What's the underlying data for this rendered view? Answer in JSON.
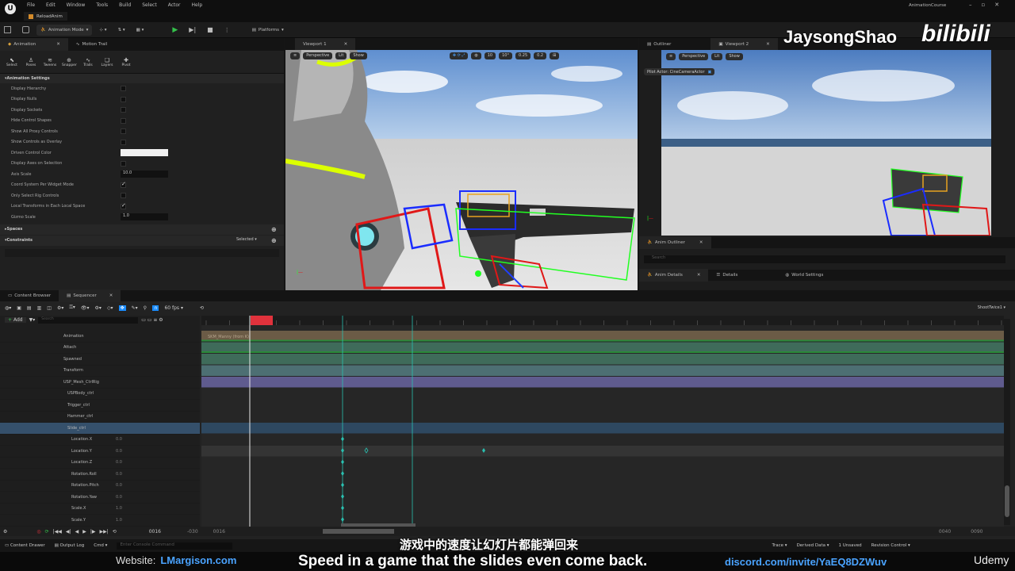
{
  "app": {
    "logo": "unreal-logo",
    "doc_tab": "ReloadAnim",
    "project": "AnimationCourse",
    "menu": [
      "File",
      "Edit",
      "Window",
      "Tools",
      "Build",
      "Select",
      "Actor",
      "Help"
    ]
  },
  "toolbar": {
    "mode": "Animation Mode",
    "platforms": "Platforms"
  },
  "anim_panel": {
    "tabs": [
      "Animation",
      "Motion Trail"
    ],
    "tools": [
      "Select",
      "Poses",
      "Tweens",
      "Snapper",
      "Trails",
      "Layers",
      "Pivot"
    ],
    "section_title": "Animation Settings",
    "settings": [
      {
        "label": "Display Hierarchy",
        "type": "check",
        "on": false
      },
      {
        "label": "Display Nulls",
        "type": "check",
        "on": false
      },
      {
        "label": "Display Sockets",
        "type": "check",
        "on": false
      },
      {
        "label": "Hide Control Shapes",
        "type": "check",
        "on": false
      },
      {
        "label": "Show All Proxy Controls",
        "type": "check",
        "on": false
      },
      {
        "label": "Show Controls as Overlay",
        "type": "check",
        "on": false
      },
      {
        "label": "Driven Control Color",
        "type": "color",
        "on": false
      },
      {
        "label": "Display Axes on Selection",
        "type": "check",
        "on": false
      },
      {
        "label": "Axis Scale",
        "type": "value",
        "value": "10.0"
      },
      {
        "label": "Coord System Per Widget Mode",
        "type": "check",
        "on": true
      },
      {
        "label": "Only Select Rig Controls",
        "type": "check",
        "on": false
      },
      {
        "label": "Local Transforms in Each Local Space",
        "type": "check",
        "on": true
      },
      {
        "label": "Gizmo Scale",
        "type": "value",
        "value": "1.0"
      }
    ],
    "spaces": "Spaces",
    "constraints": "Constraints",
    "constraints_select": "Selected"
  },
  "viewport1": {
    "tab": "Viewport 1",
    "perspective": "Perspective",
    "lit": "Lit",
    "show": "Show",
    "snap_values": [
      "10",
      "10°",
      "0.25",
      "0.2"
    ]
  },
  "right": {
    "outliner_tab": "Outliner",
    "viewport2_tab": "Viewport 2",
    "pilot_label": "Pilot Actor: CineCameraActor",
    "anim_outliner_tab": "Anim Outliner",
    "search_placeholder": "Search",
    "anim_details_tab": "Anim Details",
    "details_tab": "Details",
    "world_settings_tab": "World Settings",
    "search2_placeholder": "Search"
  },
  "watermark": {
    "author": "JaysongShao",
    "site": "bilibili"
  },
  "sequencer": {
    "tabs": [
      "Content Browser",
      "Sequencer"
    ],
    "fps": "60 fps",
    "sequence_name": "ShootTwice1",
    "add_label": "Add",
    "search_placeholder": "Search",
    "current_frame": "0016",
    "frame_start": "-030",
    "frame_in": "0016",
    "frame_out": "0040",
    "frame_end": "0090",
    "track_label": "SKM_Manny (from K)",
    "tracks": [
      {
        "label": "Animation",
        "indent": 80,
        "value": ""
      },
      {
        "label": "Attach",
        "indent": 80,
        "value": ""
      },
      {
        "label": "Spawned",
        "indent": 80,
        "value": ""
      },
      {
        "label": "Transform",
        "indent": 80,
        "value": ""
      },
      {
        "label": "USP_Mesh_CtrlRig",
        "indent": 80,
        "value": ""
      },
      {
        "label": "USPBody_ctrl",
        "indent": 85,
        "value": ""
      },
      {
        "label": "Trigger_ctrl",
        "indent": 85,
        "value": ""
      },
      {
        "label": "Hammer_ctrl",
        "indent": 85,
        "value": ""
      },
      {
        "label": "Slide_ctrl",
        "indent": 85,
        "value": "",
        "selected": true
      },
      {
        "label": "Location.X",
        "indent": 90,
        "value": "0.0"
      },
      {
        "label": "Location.Y",
        "indent": 90,
        "value": "0.0"
      },
      {
        "label": "Location.Z",
        "indent": 90,
        "value": "0.0"
      },
      {
        "label": "Rotation.Roll",
        "indent": 90,
        "value": "0.0"
      },
      {
        "label": "Rotation.Pitch",
        "indent": 90,
        "value": "0.0"
      },
      {
        "label": "Rotation.Yaw",
        "indent": 90,
        "value": "0.0"
      },
      {
        "label": "Scale.X",
        "indent": 90,
        "value": "1.0"
      },
      {
        "label": "Scale.Y",
        "indent": 90,
        "value": "1.0"
      }
    ]
  },
  "statusbar": {
    "content_drawer": "Content Drawer",
    "output_log": "Output Log",
    "cmd": "Cmd",
    "console_placeholder": "Enter Console Command",
    "trace": "Trace",
    "derived_data": "Derived Data",
    "unsaved": "1 Unsaved",
    "revision": "Revision Control"
  },
  "subtitles": {
    "chinese": "游戏中的速度让幻灯片都能弹回来",
    "english": "Speed in a game that the slides even come back.",
    "website_label": "Website:",
    "website": "LMargison.com",
    "discord": "discord.com/invite/YaEQ8DZWuv",
    "udemy": "Udemy"
  },
  "colors": {
    "accent_blue": "#1a8cff",
    "playhead_red": "#e0323c",
    "track_brown": "#6b5b46",
    "track_green": "#3f6b5a",
    "track_purple": "#5f5b8e",
    "link_blue": "#4aa3ff"
  }
}
